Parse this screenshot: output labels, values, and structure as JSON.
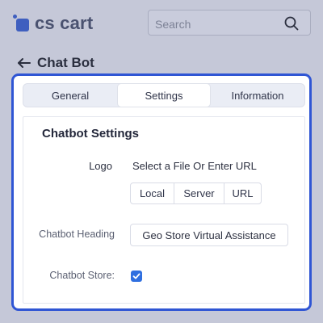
{
  "header": {
    "logo_text": "cs cart",
    "search": {
      "placeholder": "Search",
      "value": ""
    }
  },
  "page": {
    "title": "Chat Bot"
  },
  "tabs": [
    {
      "label": "General",
      "active": false
    },
    {
      "label": "Settings",
      "active": true
    },
    {
      "label": "Information",
      "active": false
    }
  ],
  "settings": {
    "section_title": "Chatbot Settings",
    "logo_label": "Logo",
    "logo_hint": "Select a File Or Enter URL",
    "logo_sources": [
      "Local",
      "Server",
      "URL"
    ],
    "heading_label": "Chatbot Heading",
    "heading_value": "Geo Store Virtual Assistance",
    "store_label": "Chatbot Store:",
    "store_checked": true
  },
  "colors": {
    "accent": "#2f55d4",
    "checkbox": "#2f6fe0",
    "overlay_bg": "#c5c8d8"
  },
  "icons": [
    "logo-icon",
    "search-icon",
    "back-arrow-icon",
    "check-icon"
  ]
}
